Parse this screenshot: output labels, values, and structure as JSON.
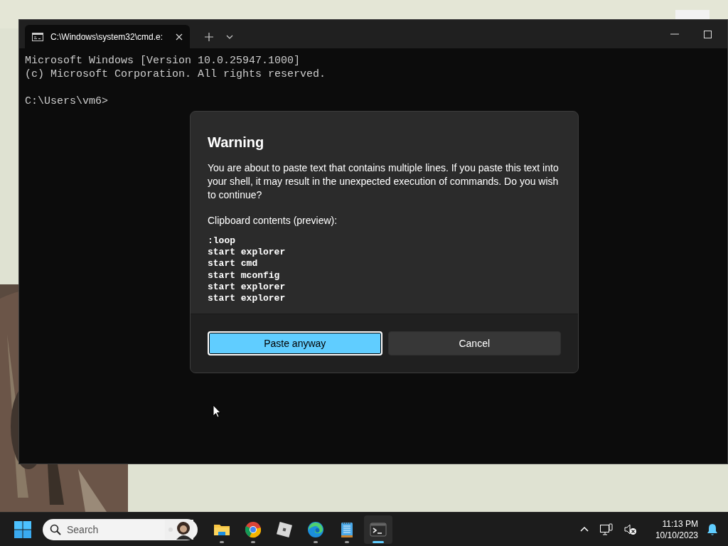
{
  "window": {
    "tab": {
      "title": "C:\\Windows\\system32\\cmd.e:",
      "selected": true
    },
    "console": {
      "output": [
        "Microsoft Windows [Version 10.0.25947.1000]",
        "(c) Microsoft Corporation. All rights reserved."
      ],
      "prompt": "C:\\Users\\vm6>"
    }
  },
  "dialog": {
    "title": "Warning",
    "message": "You are about to paste text that contains multiple lines. If you paste this text into your shell, it may result in the unexpected execution of commands. Do you wish to continue?",
    "preview_label": "Clipboard contents (preview):",
    "preview_lines": [
      ":loop",
      "start explorer",
      "start cmd",
      "start mconfig",
      "start explorer",
      "start explorer"
    ],
    "buttons": [
      {
        "label": "Paste anyway",
        "kind": "primary"
      },
      {
        "label": "Cancel",
        "kind": "secondary"
      }
    ]
  },
  "taskbar": {
    "search": {
      "placeholder": "Search"
    },
    "apps": [
      {
        "kind": "explorer",
        "running": true,
        "active": false
      },
      {
        "kind": "chrome",
        "running": true,
        "active": false
      },
      {
        "kind": "roblox",
        "running": false,
        "active": false
      },
      {
        "kind": "edge",
        "running": true,
        "active": false
      },
      {
        "kind": "notepad",
        "running": true,
        "active": false
      },
      {
        "kind": "terminal",
        "running": true,
        "active": true
      }
    ],
    "clock": {
      "time": "11:13 PM",
      "date": "10/10/2023"
    }
  }
}
